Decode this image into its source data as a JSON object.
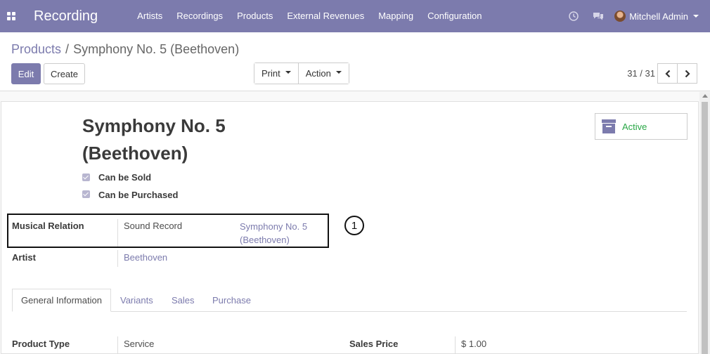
{
  "navbar": {
    "app_title": "Recording",
    "menu": [
      "Artists",
      "Recordings",
      "Products",
      "External Revenues",
      "Mapping",
      "Configuration"
    ],
    "user_name": "Mitchell Admin",
    "color": "#7c7bad"
  },
  "breadcrumb": {
    "parent": "Products",
    "separator": "/",
    "current": "Symphony No. 5 (Beethoven)"
  },
  "toolbar": {
    "edit_label": "Edit",
    "create_label": "Create",
    "print_label": "Print",
    "action_label": "Action"
  },
  "pager": {
    "value": "31 / 31"
  },
  "record": {
    "title_line1": "Symphony No. 5",
    "title_line2": "(Beethoven)",
    "can_be_sold_label": "Can be Sold",
    "can_be_sold": true,
    "can_be_purchased_label": "Can be Purchased",
    "can_be_purchased": true,
    "active_button_label": "Active",
    "musical_relation_label": "Musical Relation",
    "musical_relation_model": "Sound Record",
    "musical_relation_value_line1": "Symphony No. 5",
    "musical_relation_value_line2": "(Beethoven)",
    "annotation_number": "1",
    "artist_label": "Artist",
    "artist_value": "Beethoven"
  },
  "tabs": [
    "General Information",
    "Variants",
    "Sales",
    "Purchase"
  ],
  "general": {
    "product_type_label": "Product Type",
    "product_type_value": "Service",
    "sales_price_label": "Sales Price",
    "sales_price_value": "$ 1.00"
  }
}
